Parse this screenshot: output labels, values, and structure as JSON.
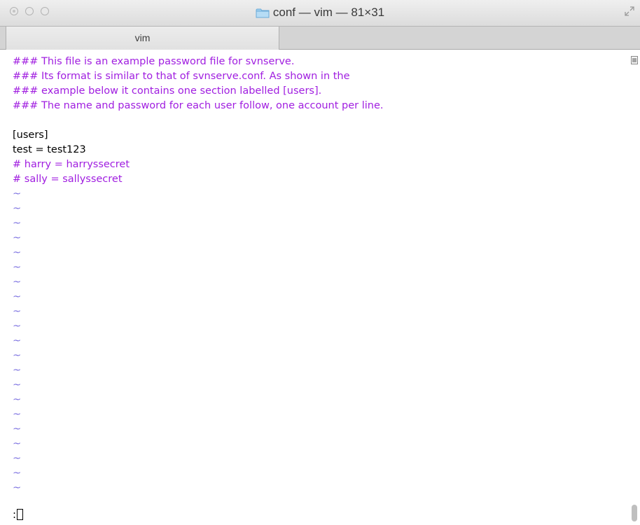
{
  "window": {
    "title": "conf — vim — 81×31",
    "tab_label": "vim"
  },
  "terminal": {
    "lines": [
      {
        "text": "### This file is an example password file for svnserve.",
        "kind": "comment"
      },
      {
        "text": "### Its format is similar to that of svnserve.conf. As shown in the",
        "kind": "comment"
      },
      {
        "text": "### example below it contains one section labelled [users].",
        "kind": "comment"
      },
      {
        "text": "### The name and password for each user follow, one account per line.",
        "kind": "comment"
      },
      {
        "text": "",
        "kind": "normal"
      },
      {
        "text": "[users]",
        "kind": "normal"
      },
      {
        "text": "test = test123",
        "kind": "normal"
      },
      {
        "text": "# harry = harryssecret",
        "kind": "comment"
      },
      {
        "text": "# sally = sallyssecret",
        "kind": "comment"
      },
      {
        "text": "~",
        "kind": "tilde"
      },
      {
        "text": "~",
        "kind": "tilde"
      },
      {
        "text": "~",
        "kind": "tilde"
      },
      {
        "text": "~",
        "kind": "tilde"
      },
      {
        "text": "~",
        "kind": "tilde"
      },
      {
        "text": "~",
        "kind": "tilde"
      },
      {
        "text": "~",
        "kind": "tilde"
      },
      {
        "text": "~",
        "kind": "tilde"
      },
      {
        "text": "~",
        "kind": "tilde"
      },
      {
        "text": "~",
        "kind": "tilde"
      },
      {
        "text": "~",
        "kind": "tilde"
      },
      {
        "text": "~",
        "kind": "tilde"
      },
      {
        "text": "~",
        "kind": "tilde"
      },
      {
        "text": "~",
        "kind": "tilde"
      },
      {
        "text": "~",
        "kind": "tilde"
      },
      {
        "text": "~",
        "kind": "tilde"
      },
      {
        "text": "~",
        "kind": "tilde"
      },
      {
        "text": "~",
        "kind": "tilde"
      },
      {
        "text": "~",
        "kind": "tilde"
      },
      {
        "text": "~",
        "kind": "tilde"
      },
      {
        "text": "~",
        "kind": "tilde"
      }
    ],
    "command_line": ":"
  },
  "colors": {
    "comment": "#a01ee0",
    "tilde": "#7a6fe0",
    "text": "#000000"
  },
  "icons": {
    "folder": "folder-icon",
    "fullscreen": "fullscreen-icon"
  }
}
